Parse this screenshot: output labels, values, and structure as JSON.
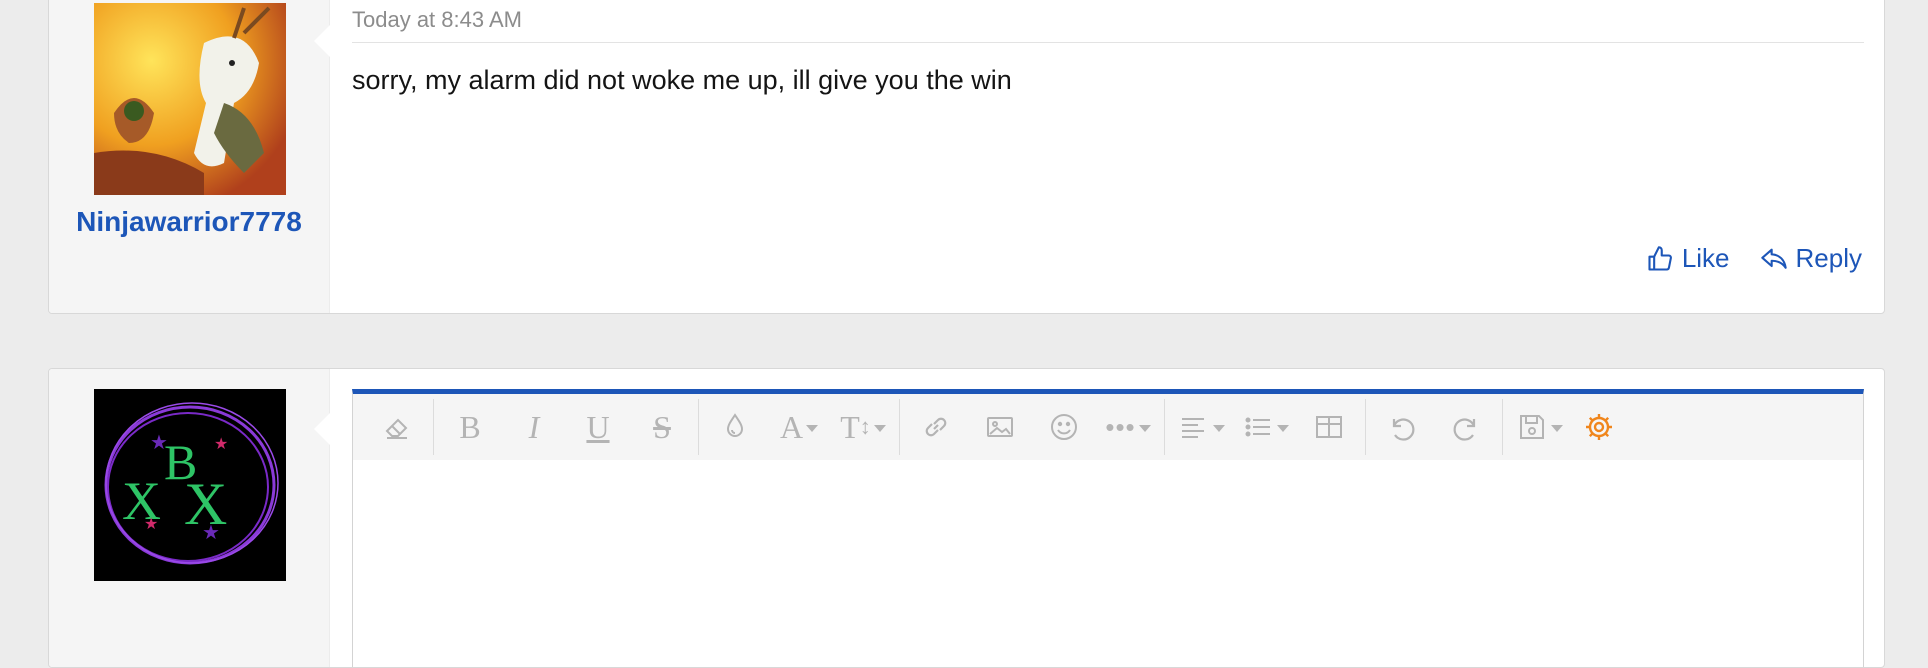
{
  "posts": [
    {
      "username": "Ninjawarrior7778",
      "timestamp": "Today at 8:43 AM",
      "message": "sorry, my alarm did not woke me up, ill give you the win",
      "actions": {
        "like": "Like",
        "reply": "Reply"
      }
    }
  ],
  "editor": {
    "toolbar": [
      "eraser-icon",
      "bold-icon",
      "italic-icon",
      "underline-icon",
      "strikethrough-icon",
      "text-color-icon",
      "font-family-icon",
      "font-size-icon",
      "link-icon",
      "image-icon",
      "smiley-icon",
      "more-icon",
      "align-icon",
      "list-icon",
      "table-icon",
      "undo-icon",
      "redo-icon",
      "save-draft-icon",
      "settings-gear-icon"
    ],
    "accent": "#1d56b8",
    "gear_color": "#f0861c"
  }
}
